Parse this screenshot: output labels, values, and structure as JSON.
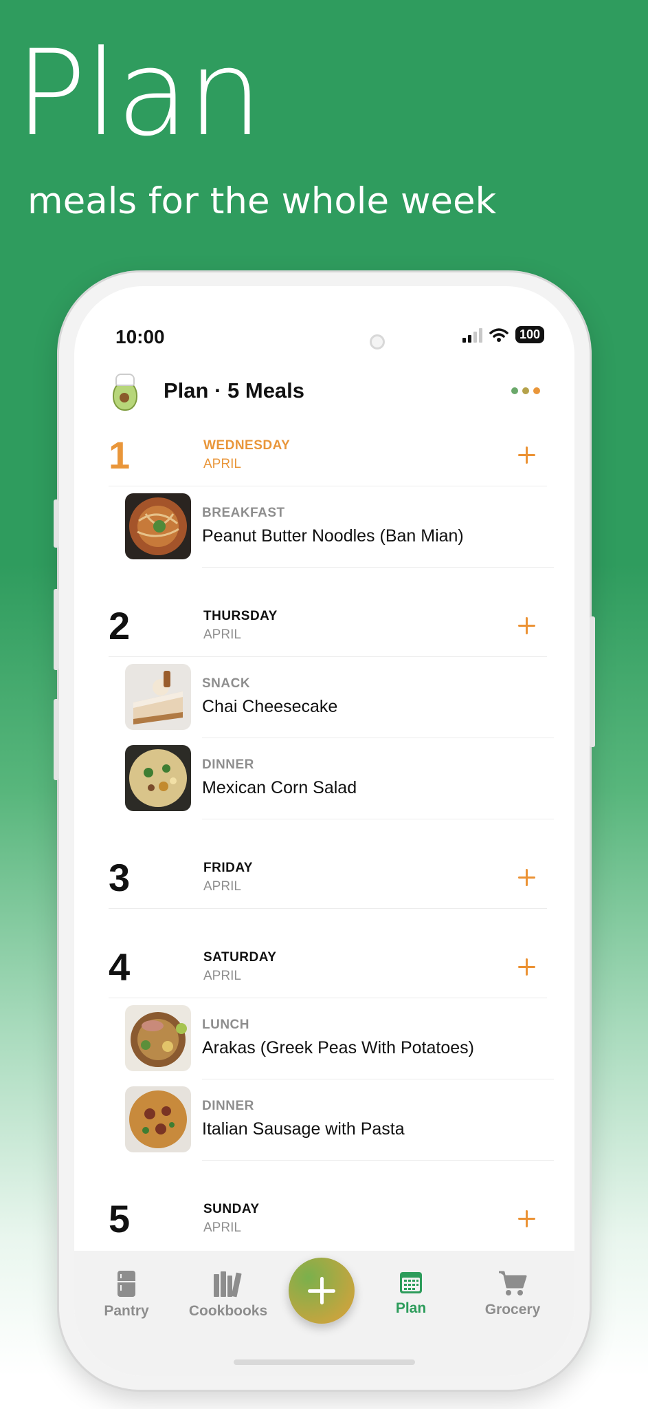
{
  "hero": {
    "title": "Plan",
    "subtitle": "meals for the whole week"
  },
  "status_bar": {
    "time": "10:00",
    "battery": "100"
  },
  "header": {
    "title": "Plan · 5 Meals"
  },
  "days": [
    {
      "number": "1",
      "weekday": "WEDNESDAY",
      "month": "APRIL",
      "today": true
    },
    {
      "number": "2",
      "weekday": "THURSDAY",
      "month": "APRIL"
    },
    {
      "number": "3",
      "weekday": "FRIDAY",
      "month": "APRIL"
    },
    {
      "number": "4",
      "weekday": "SATURDAY",
      "month": "APRIL"
    },
    {
      "number": "5",
      "weekday": "SUNDAY",
      "month": "APRIL"
    }
  ],
  "meals": [
    {
      "type": "BREAKFAST",
      "name": "Peanut Butter Noodles (Ban Mian)"
    },
    {
      "type": "SNACK",
      "name": "Chai Cheesecake"
    },
    {
      "type": "DINNER",
      "name": "Mexican Corn Salad"
    },
    {
      "type": "LUNCH",
      "name": "Arakas (Greek Peas With Potatoes)"
    },
    {
      "type": "DINNER",
      "name": "Italian Sausage with Pasta"
    }
  ],
  "tabs": [
    {
      "label": "Pantry",
      "icon": "fridge-icon"
    },
    {
      "label": "Cookbooks",
      "icon": "books-icon"
    },
    {
      "label": "Plan",
      "icon": "calendar-icon",
      "active": true
    },
    {
      "label": "Grocery",
      "icon": "cart-icon"
    }
  ],
  "colors": {
    "brand_green": "#2f9c5e",
    "accent_orange": "#eb9234",
    "active_tab": "#2d9c5b"
  }
}
